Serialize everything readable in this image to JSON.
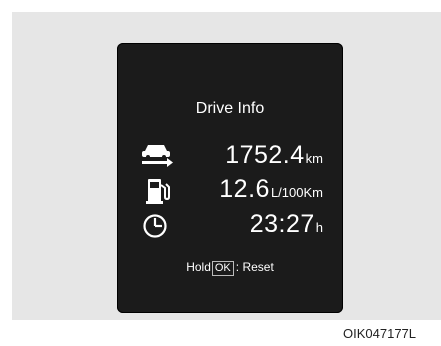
{
  "screen": {
    "title": "Drive Info",
    "rows": [
      {
        "icon": "car-distance-icon",
        "value": "1752.4",
        "unit": "km"
      },
      {
        "icon": "fuel-pump-icon",
        "value": "12.6",
        "unit": "L/100Km"
      },
      {
        "icon": "clock-icon",
        "value": "23:27",
        "unit": "h"
      }
    ],
    "footer": {
      "hold": "Hold",
      "ok": "OK",
      "reset": ": Reset"
    }
  },
  "caption": "OIK047177L",
  "colors": {
    "screen_bg": "#1b1b1b",
    "text": "#ffffff",
    "frame_bg": "#e6e6e6"
  }
}
